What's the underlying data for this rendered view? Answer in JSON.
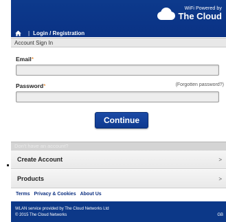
{
  "header": {
    "brand_small": "WiFi Powered by",
    "brand_name": "The Cloud",
    "nav_label": "Login / Registration"
  },
  "sign_in": {
    "section_title": "Account Sign In",
    "email_label": "Email",
    "password_label": "Password",
    "required_mark": "*",
    "forgot_label": "(Forgotten password?)",
    "email_value": "",
    "password_value": "",
    "continue_label": "Continue"
  },
  "account": {
    "prompt": "Don't have an account?",
    "items": [
      {
        "label": "Create Account",
        "chevron": ">"
      },
      {
        "label": "Products",
        "chevron": ">"
      }
    ]
  },
  "links": [
    "Terms",
    "Privacy & Cookies",
    "About Us"
  ],
  "footer": {
    "provider": "WLAN service provided by The Cloud Networks Ltd",
    "copyright": "© 2015 The Cloud Networks",
    "region": "GB"
  },
  "colors": {
    "brand_blue": "#0d3a8c",
    "button_blue": "#1b4aa6",
    "required_orange": "#e07a1b"
  },
  "icons": [
    "home-icon",
    "cloud-icon"
  ]
}
